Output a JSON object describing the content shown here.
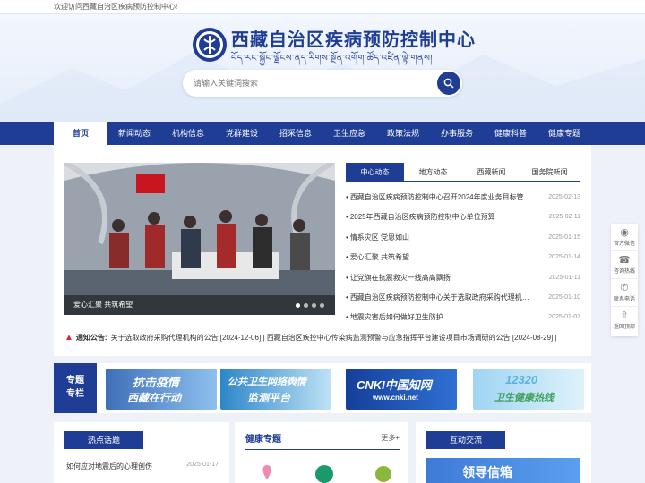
{
  "topbar": {
    "welcome": "欢迎访问西藏自治区疾病预防控制中心!"
  },
  "header": {
    "title": "西藏自治区疾病预防控制中心",
    "subtitle_tibetan": "བོད་རང་སྐྱོང་ལྗོངས་ནད་རིགས་སྔོན་འགོག་ཚོད་འཛིན་ལྟེ་གནས།"
  },
  "search": {
    "placeholder": "请输入关键词搜索"
  },
  "nav": {
    "items": [
      {
        "label": "首页",
        "active": true
      },
      {
        "label": "新闻动态"
      },
      {
        "label": "机构信息"
      },
      {
        "label": "党群建设"
      },
      {
        "label": "招采信息"
      },
      {
        "label": "卫生应急"
      },
      {
        "label": "政策法规"
      },
      {
        "label": "办事服务"
      },
      {
        "label": "健康科普"
      },
      {
        "label": "健康专题"
      }
    ]
  },
  "slider": {
    "caption": "爱心汇聚 共筑希望",
    "slides": 4,
    "current": 1
  },
  "news": {
    "tabs": [
      "中心动态",
      "地方动态",
      "西藏新闻",
      "国务院新闻"
    ],
    "items": [
      {
        "title": "西藏自治区疾病预防控制中心召开2024年度业务目标管…",
        "date": "2025-02-13"
      },
      {
        "title": "2025年西藏自治区疾病预防控制中心单位预算",
        "date": "2025-02-11"
      },
      {
        "title": "情系灾区 党恩如山",
        "date": "2025-01-15"
      },
      {
        "title": "爱心汇聚 共筑希望",
        "date": "2025-01-14"
      },
      {
        "title": "让党旗在抗震救灾一线高高飘扬",
        "date": "2025-01-11"
      },
      {
        "title": "西藏自治区疾病预防控制中心关于选取政府采购代理机…",
        "date": "2025-01-10"
      },
      {
        "title": "地震灾害后如何做好卫生防护",
        "date": "2025-01-07"
      }
    ]
  },
  "notice": {
    "label": "通知公告:",
    "text": "关于选取政府采购代理机构的公告 [2024-12-06]  |   西藏自治区疾控中心传染病监测预警与应急指挥平台建设项目市场调研的公告 [2024-08-29]  |"
  },
  "special": {
    "label_line1": "专题",
    "label_line2": "专栏",
    "banners": [
      {
        "line1": "抗击疫情",
        "line2": "西藏在行动"
      },
      {
        "line1": "公共卫生网络舆情",
        "line2": "监测平台"
      },
      {
        "line1": "CNKI中国知网",
        "line2": "www.cnki.net"
      },
      {
        "line1": "12320",
        "line2": "卫生健康热线"
      }
    ]
  },
  "hot": {
    "title": "热点话题",
    "item": "如何应对地震后的心理创伤",
    "date": "2025-01-17"
  },
  "health": {
    "title": "健康专题",
    "more": "更多+"
  },
  "interact": {
    "title": "互动交流",
    "banner": "领导信箱"
  },
  "side": [
    {
      "label": "官方微信",
      "icon": "wechat-icon"
    },
    {
      "label": "咨询热线",
      "icon": "headset-icon"
    },
    {
      "label": "联系电话",
      "icon": "phone-icon"
    },
    {
      "label": "返回顶部",
      "icon": "arrow-up-icon"
    }
  ],
  "colors": {
    "brand": "#1f3d94",
    "notice_icon": "#dd2233"
  }
}
